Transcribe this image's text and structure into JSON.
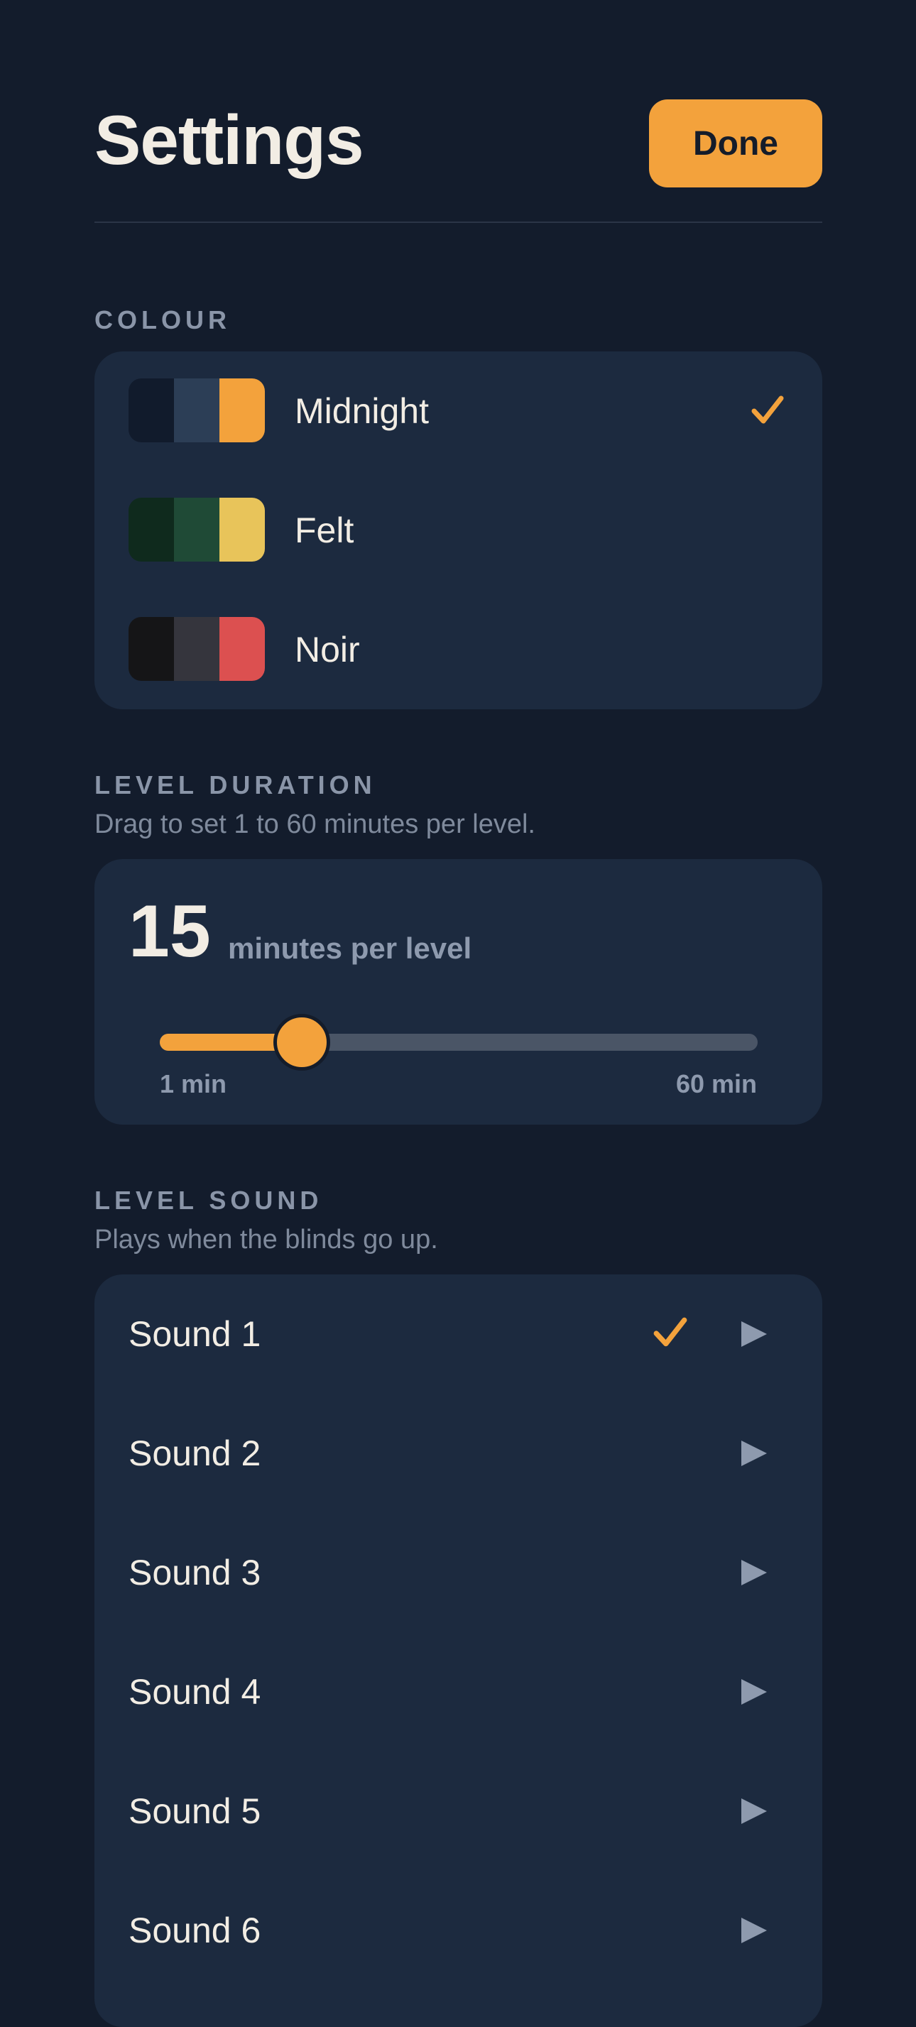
{
  "header": {
    "title": "Settings",
    "done_label": "Done"
  },
  "colour": {
    "label": "COLOUR",
    "selected": "Midnight",
    "themes": [
      {
        "name": "Midnight",
        "selected": true,
        "colors": [
          "#111b2c",
          "#2c3e56",
          "#f3a23c"
        ]
      },
      {
        "name": "Felt",
        "selected": false,
        "colors": [
          "#0f2a1d",
          "#1f4a36",
          "#e8c45a"
        ]
      },
      {
        "name": "Noir",
        "selected": false,
        "colors": [
          "#151517",
          "#35353d",
          "#dc5050"
        ]
      }
    ]
  },
  "duration": {
    "label": "LEVEL DURATION",
    "subtitle": "Drag to set 1 to 60 minutes per level.",
    "value": "15",
    "unit": "minutes per level",
    "min_label": "1 min",
    "max_label": "60 min",
    "min": 1,
    "max": 60,
    "current": 15
  },
  "sound": {
    "label": "LEVEL SOUND",
    "subtitle": "Plays when the blinds go up.",
    "items": [
      {
        "name": "Sound 1",
        "selected": true
      },
      {
        "name": "Sound 2",
        "selected": false
      },
      {
        "name": "Sound 3",
        "selected": false
      },
      {
        "name": "Sound 4",
        "selected": false
      },
      {
        "name": "Sound 5",
        "selected": false
      },
      {
        "name": "Sound 6",
        "selected": false
      }
    ]
  },
  "colors": {
    "background": "#131c2c",
    "card": "#1c2a3f",
    "accent": "#f3a23c",
    "text": "#f2ede4",
    "muted": "#8a95a8"
  },
  "icons": {
    "check": "checkmark-icon",
    "play": "play-icon"
  }
}
